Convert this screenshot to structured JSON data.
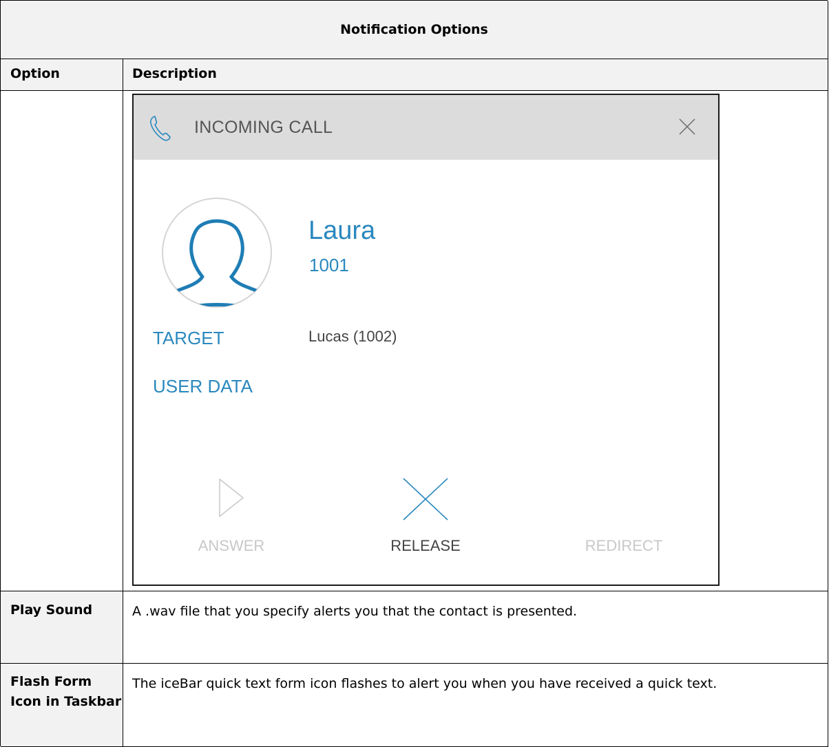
{
  "table": {
    "title": "Notification Options",
    "headers": [
      "Option",
      "Description"
    ],
    "rows": [
      {
        "option": "Play Sound",
        "description": "A .wav file that you specify alerts you that the contact is presented."
      },
      {
        "option": "Flash Form Icon in Taskbar",
        "description": "The iceBar quick text form icon flashes to alert you when you have received a quick text."
      }
    ]
  },
  "popup": {
    "title": "INCOMING CALL",
    "caller_name": "Laura",
    "caller_number": "1001",
    "target_label": "TARGET",
    "target_value": "Lucas (1002)",
    "user_data_label": "USER DATA",
    "actions": {
      "answer": "ANSWER",
      "release": "RELEASE",
      "redirect": "REDIRECT"
    },
    "colors": {
      "accent": "#2a88be",
      "header_bg": "#dcdcdc",
      "disabled": "#c8c8c8"
    }
  }
}
